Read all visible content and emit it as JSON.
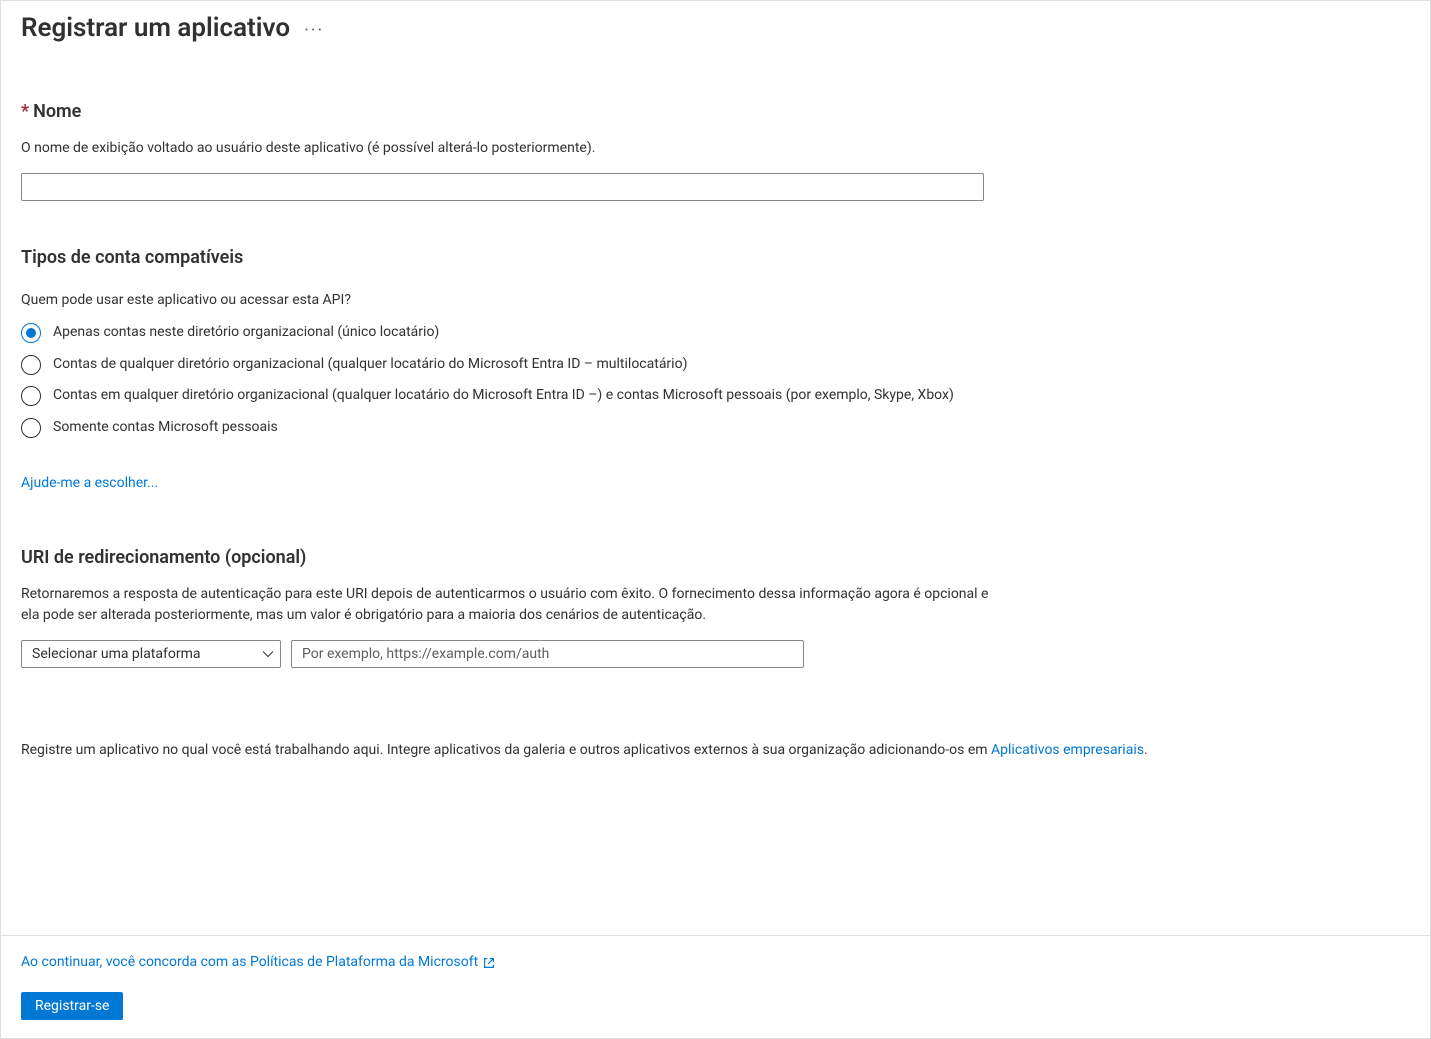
{
  "header": {
    "title": "Registrar um aplicativo"
  },
  "name_section": {
    "label": "Nome",
    "description": "O nome de exibição voltado ao usuário deste aplicativo (é possível alterá-lo posteriormente).",
    "value": ""
  },
  "accounts_section": {
    "heading": "Tipos de conta compatíveis",
    "question": "Quem pode usar este aplicativo ou acessar esta API?",
    "options": [
      "Apenas contas neste diretório organizacional (único locatário)",
      "Contas de qualquer diretório organizacional (qualquer locatário do Microsoft Entra ID – multilocatário)",
      "Contas em qualquer diretório organizacional (qualquer locatário do Microsoft Entra ID –) e contas Microsoft pessoais (por exemplo, Skype, Xbox)",
      "Somente contas Microsoft pessoais"
    ],
    "help_link": "Ajude-me a escolher..."
  },
  "redirect_section": {
    "heading": "URI de redirecionamento (opcional)",
    "description": "Retornaremos a resposta de autenticação para este URI depois de autenticarmos o usuário com êxito. O fornecimento dessa informação agora é opcional e ela pode ser alterada posteriormente, mas um valor é obrigatório para a maioria dos cenários de autenticação.",
    "platform_selected": "Selecionar uma plataforma",
    "uri_placeholder": "Por exemplo, https://example.com/auth",
    "uri_value": ""
  },
  "bottom_note": {
    "prefix": "Registre um aplicativo no qual você está trabalhando aqui. Integre aplicativos da galeria e outros aplicativos externos à sua organização adicionando-os em ",
    "link": "Aplicativos empresariais",
    "suffix": "."
  },
  "footer": {
    "agree_text": "Ao continuar, você concorda com as Políticas de Plataforma da Microsoft",
    "register_button": "Registrar-se"
  }
}
